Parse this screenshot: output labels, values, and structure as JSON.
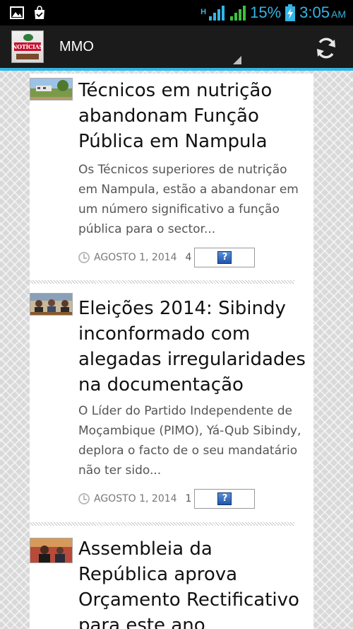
{
  "status_bar": {
    "left_icons": [
      "image-icon",
      "shopping-bag-icon"
    ],
    "network_label": "H",
    "battery_percent": "15%",
    "time": "3:05",
    "ampm": "AM"
  },
  "action_bar": {
    "title": "MMO",
    "logo_text": "NOTÍCIAS"
  },
  "articles": [
    {
      "title": "Técnicos em nutrição abandonam Função Pública em Nampula",
      "summary": "Os Técnicos superiores de nutrição em Nampula, estão a abandonar em um número significativo a função pública para o sector...",
      "date": "AGOSTO 1, 2014",
      "count": "4"
    },
    {
      "title": "Eleições 2014: Sibindy inconformado com alegadas irregularidades na documentação",
      "summary": "O Líder do Partido Independente de Moçambique (PIMO), Yá-Qub Sibindy, deplora o facto de o seu mandatário não ter sido...",
      "date": "AGOSTO 1, 2014",
      "count": "1"
    },
    {
      "title": "Assembleia da República aprova Orçamento Rectificativo para este ano"
    }
  ],
  "colors": {
    "accent": "#33b5e5",
    "action_bar_bg": "#1b1b1b",
    "status_bar_bg": "#000000"
  }
}
